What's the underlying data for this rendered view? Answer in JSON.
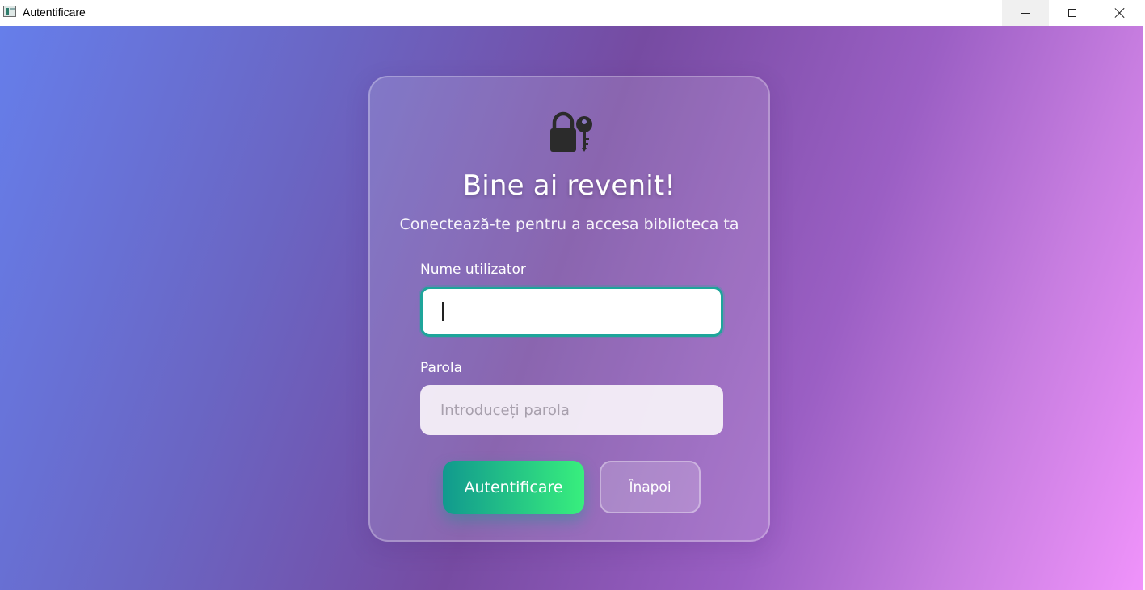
{
  "window": {
    "title": "Autentificare",
    "controls": {
      "minimize": "minimize-icon",
      "maximize": "maximize-icon",
      "close": "close-icon"
    }
  },
  "login": {
    "icon": "lock-key-icon",
    "title": "Bine ai revenit!",
    "subtitle": "Conectează-te pentru a accesa biblioteca ta",
    "username_label": "Nume utilizator",
    "username_value": "",
    "password_label": "Parola",
    "password_placeholder": "Introduceți parola",
    "password_value": "",
    "login_button": "Autentificare",
    "back_button": "Înapoi"
  },
  "colors": {
    "background_start": "#667eea",
    "background_mid": "#764ba2",
    "background_end": "#f093fb",
    "login_button_start": "#11998e",
    "login_button_end": "#38ef7d",
    "input_focus_border": "#1ea59a"
  }
}
